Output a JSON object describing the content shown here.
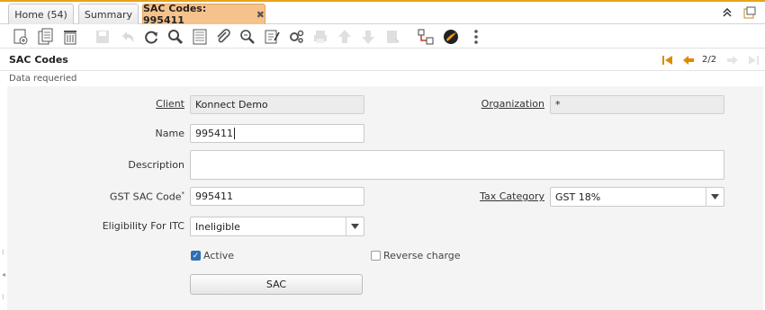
{
  "tabs": [
    {
      "label": "Home (54)"
    },
    {
      "label": "Summary"
    },
    {
      "label": "SAC Codes: 995411",
      "active": true
    }
  ],
  "header": {
    "title": "SAC Codes",
    "record_position": "2/2"
  },
  "status": {
    "message": "Data requeried"
  },
  "form": {
    "client": {
      "label": "Client",
      "value": "Konnect Demo"
    },
    "organization": {
      "label": "Organization",
      "value": "*"
    },
    "name": {
      "label": "Name",
      "value": "995411"
    },
    "description": {
      "label": "Description",
      "value": ""
    },
    "gst_sac_code": {
      "label": "GST SAC Code",
      "required_mark": "*",
      "value": "995411"
    },
    "tax_category": {
      "label": "Tax Category",
      "value": "GST 18%"
    },
    "eligibility_for_itc": {
      "label": "Eligibility For ITC",
      "value": "Ineligible"
    },
    "active": {
      "label": "Active",
      "checked": true
    },
    "reverse_charge": {
      "label": "Reverse charge",
      "checked": false
    },
    "sac_button": {
      "label": "SAC"
    }
  },
  "colors": {
    "accent": "#e8a317",
    "active_tab": "#f6c28b",
    "checkbox": "#2f6fb5"
  }
}
